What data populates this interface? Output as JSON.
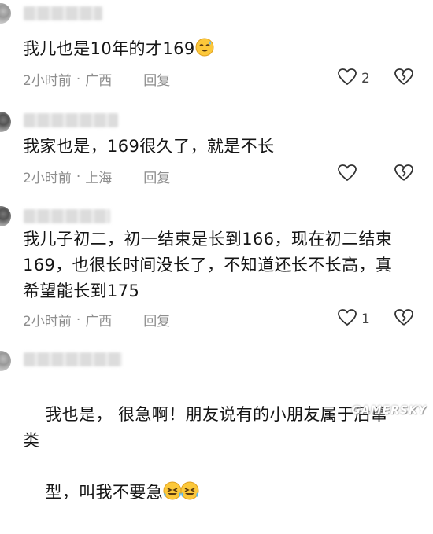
{
  "comments": [
    {
      "text": "我儿也是10年的才169",
      "time": "2小时前",
      "location": "广西",
      "reply_label": "回复",
      "like_count": "2",
      "emoji": "sweat-smile-face"
    },
    {
      "text": "我家也是，169很久了，就是不长",
      "time": "2小时前",
      "location": "上海",
      "reply_label": "回复",
      "like_count": ""
    },
    {
      "text": "我儿子初二，初一结束是长到166，现在初二结束169，也很长时间没长了，不知道还长不长高，真希望能长到175",
      "time": "2小时前",
      "location": "广西",
      "reply_label": "回复",
      "like_count": "1"
    },
    {
      "text_line1": "我也是， 很急啊！朋友说有的小朋友属于后窜类",
      "text_line2": "型，叫我不要急",
      "emoji": "laughing-tears-face"
    }
  ],
  "separator": "·",
  "watermark": "GAMERSKY",
  "colors": {
    "text": "#151515",
    "meta": "#8e8e8e",
    "background": "#ffffff"
  }
}
